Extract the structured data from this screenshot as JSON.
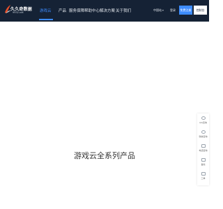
{
  "header": {
    "logo_name": "久久奇数据",
    "logo_domain": "9932.net",
    "nav": [
      {
        "label": "游戏云",
        "active": true
      },
      {
        "label": "产品",
        "active": false
      },
      {
        "label": "服务保障",
        "active": false
      },
      {
        "label": "帮助中心",
        "active": false
      },
      {
        "label": "解决方案",
        "active": false
      },
      {
        "label": "关于我们",
        "active": false
      }
    ],
    "language": "中国站",
    "login": "登录",
    "register": "免费注册",
    "console": "控制台"
  },
  "hero": {
    "title": "游戏云全系列产品"
  },
  "side_panel": {
    "items": [
      {
        "label": "QQ咨询",
        "icon": "qq-icon"
      },
      {
        "label": "微信咨询",
        "icon": "wechat-icon"
      },
      {
        "label": "电话咨询",
        "icon": "phone-icon"
      },
      {
        "label": "备案",
        "icon": "record-icon"
      },
      {
        "label": "工单",
        "icon": "ticket-icon"
      }
    ]
  },
  "colors": {
    "header_bg": "#152235",
    "accent": "#3d8cff",
    "page_bg": "#ffffff"
  }
}
